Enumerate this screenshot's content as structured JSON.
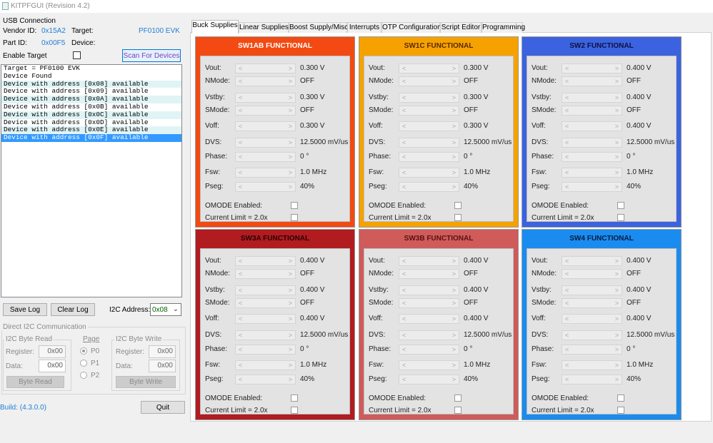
{
  "window": {
    "title": "KITPFGUI (Revision 4.2)"
  },
  "usb": {
    "section_title": "USB Connection",
    "vendor_label": "Vendor ID:",
    "vendor_value": "0x15A2",
    "target_label": "Target:",
    "target_value": "PF0100 EVK",
    "part_label": "Part ID:",
    "part_value": "0x00F5",
    "device_label": "Device:",
    "enable_target_label": "Enable Target",
    "scan_button": "Scan For Devices"
  },
  "log": {
    "lines": [
      "Target = PF0100 EVK",
      "Device Found",
      "Device with address [0x08] available",
      "Device with address [0x09] available",
      "Device with address [0x0A] available",
      "Device with address [0x0B] available",
      "Device with address [0x0C] available",
      "Device with address [0x0D] available",
      "Device with address [0x0E] available",
      "Device with address [0x0F] available"
    ]
  },
  "controls": {
    "save_log": "Save Log",
    "clear_log": "Clear Log",
    "i2c_address_label": "I2C Address:",
    "i2c_address_value": "0x08"
  },
  "direct": {
    "title": "Direct I2C Communication",
    "read_title": "I2C Byte Read",
    "write_title": "I2C Byte Write",
    "page_title": "Page",
    "register_label": "Register:",
    "data_label": "Data:",
    "read_register": "0x00",
    "read_data": "0x00",
    "write_register": "0x00",
    "write_data": "0x00",
    "page_options": [
      "P0",
      "P1",
      "P2"
    ],
    "byte_read": "Byte Read",
    "byte_write": "Byte Write"
  },
  "footer": {
    "build": "Build: (4.3.0.0)",
    "quit": "Quit"
  },
  "tabs": [
    "Buck Supplies",
    "Linear Supplies",
    "Boost Supply/Misc",
    "Interrupts",
    "OTP Configuration",
    "Script Editor",
    "Programming"
  ],
  "labels": {
    "vout": "Vout:",
    "nmode": "NMode:",
    "vstby": "Vstby:",
    "smode": "SMode:",
    "voff": "Voff:",
    "dvs": "DVS:",
    "phase": "Phase:",
    "fsw": "Fsw:",
    "pseg": "Pseg:",
    "omode": "OMODE Enabled:",
    "current_limit": "Current Limit = 2.0x",
    "arrow_left": "<",
    "arrow_right": ">"
  },
  "panels": [
    {
      "title": "SW1AB FUNCTIONAL",
      "color": "#f24a12",
      "title_color": "#ffffff",
      "vout": "0.300 V",
      "nmode": "OFF",
      "vstby": "0.300 V",
      "smode": "OFF",
      "voff": "0.300 V",
      "dvs": "12.5000 mV/us",
      "phase": "0 °",
      "fsw": "1.0 MHz",
      "pseg": "40%"
    },
    {
      "title": "SW1C FUNCTIONAL",
      "color": "#f5a200",
      "title_color": "#5a2a00",
      "vout": "0.300 V",
      "nmode": "OFF",
      "vstby": "0.300 V",
      "smode": "OFF",
      "voff": "0.300 V",
      "dvs": "12.5000 mV/us",
      "phase": "0 °",
      "fsw": "1.0 MHz",
      "pseg": "40%"
    },
    {
      "title": "SW2 FUNCTIONAL",
      "color": "#3b63e0",
      "title_color": "#101040",
      "vout": "0.400 V",
      "nmode": "OFF",
      "vstby": "0.400 V",
      "smode": "OFF",
      "voff": "0.400 V",
      "dvs": "12.5000 mV/us",
      "phase": "0 °",
      "fsw": "1.0 MHz",
      "pseg": "40%"
    },
    {
      "title": "SW3A FUNCTIONAL",
      "color": "#b01c20",
      "title_color": "#2a0000",
      "vout": "0.400 V",
      "nmode": "OFF",
      "vstby": "0.400 V",
      "smode": "OFF",
      "voff": "0.400 V",
      "dvs": "12.5000 mV/us",
      "phase": "0 °",
      "fsw": "1.0 MHz",
      "pseg": "40%"
    },
    {
      "title": "SW3B FUNCTIONAL",
      "color": "#cf5b5b",
      "title_color": "#5a1010",
      "vout": "0.400 V",
      "nmode": "OFF",
      "vstby": "0.400 V",
      "smode": "OFF",
      "voff": "0.400 V",
      "dvs": "12.5000 mV/us",
      "phase": "0 °",
      "fsw": "1.0 MHz",
      "pseg": "40%"
    },
    {
      "title": "SW4 FUNCTIONAL",
      "color": "#1a8cf0",
      "title_color": "#0a1a40",
      "vout": "0.400 V",
      "nmode": "OFF",
      "vstby": "0.400 V",
      "smode": "OFF",
      "voff": "0.400 V",
      "dvs": "12.5000 mV/us",
      "phase": "0 °",
      "fsw": "1.0 MHz",
      "pseg": "40%"
    }
  ]
}
